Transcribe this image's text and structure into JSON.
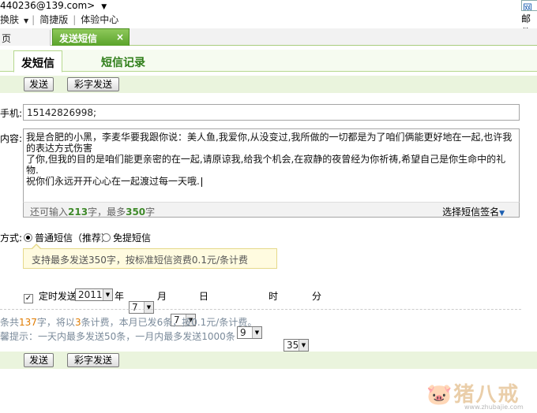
{
  "header": {
    "account": "440236@139.com>",
    "links": [
      "换肤",
      "简捷版",
      "体验中心"
    ],
    "right_top": "网上",
    "right_mail": "邮件"
  },
  "tabs": [
    {
      "label": "页"
    },
    {
      "label": "发送短信",
      "close": "×"
    }
  ],
  "subtabs": {
    "active": "发短信",
    "other": "短信记录"
  },
  "toolbar": {
    "send": "发送",
    "color_send": "彩字发送"
  },
  "form": {
    "phone_label": "手机:",
    "phone_value": "15142826998;",
    "content_label": "内容:",
    "content_lines": [
      "我是合肥的小黑，李麦华要我跟你说：美人鱼,我爱你,从没变过,我所做的一切都是为了咱们俩能更好地在一起,也许我的表达方式伤害",
      "了你,但我的目的是咱们能更亲密的在一起,请原谅我,给我个机会,在寂静的夜曾经为你祈祷,希望自己是你生命中的礼物.",
      "祝你们永远开开心心在一起渡过每一天哦."
    ],
    "count_prefix": "还可输入",
    "count_remaining": "213",
    "count_mid": "字，最多",
    "count_max": "350",
    "count_suffix": "字",
    "signature": "选择短信签名",
    "mode_label": "方式:",
    "mode_normal": "普通短信（推荐）",
    "mode_free": "免提短信",
    "tip": "支持最多发送350字，按标准短信资费0.1元/条计费",
    "timed_label": "定时发送",
    "year": "2011",
    "year_unit": "年",
    "month": "7",
    "month_unit": "月",
    "day": "7",
    "day_unit": "日",
    "hour": "9",
    "hour_unit": "时",
    "minute": "35",
    "minute_unit": "分"
  },
  "info": {
    "line1_a": "条共",
    "chars": "137",
    "line1_b": "字，将以",
    "parts": "3",
    "line1_c": "条计费，本月已发6条，按0.1元/条计费。",
    "line2": "馨提示：一天内最多发送50条，一月内最多发送1000条"
  },
  "watermark": {
    "text": "猪八戒",
    "url": "www.zhubajie.com"
  }
}
